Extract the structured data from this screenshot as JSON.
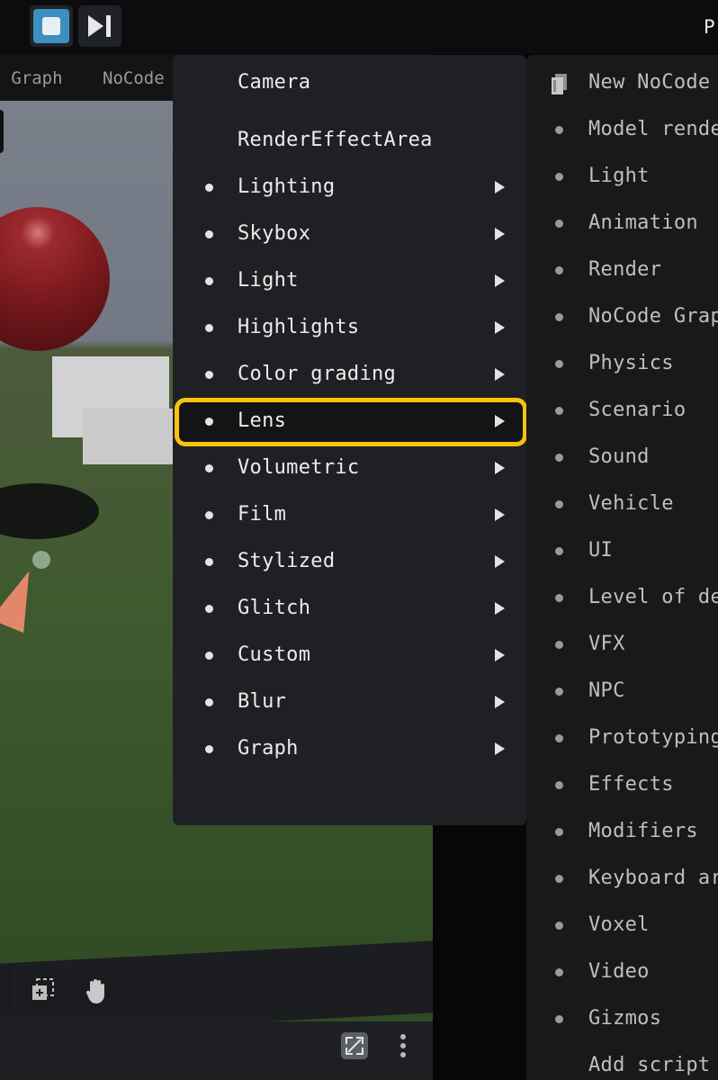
{
  "toolbar": {
    "stop_icon": "stop-icon",
    "step_icon": "step-forward-icon",
    "right_text": "P"
  },
  "tabs": [
    {
      "label": "al Graph"
    },
    {
      "label": "NoCode"
    }
  ],
  "viewport": {
    "tools": [
      {
        "icon": "tool-icon"
      },
      {
        "icon": "add-frame-icon"
      },
      {
        "icon": "hand-icon"
      }
    ],
    "bottom": {
      "fullscreen_icon": "fullscreen-icon",
      "more_icon": "more-vertical-icon"
    }
  },
  "menu": {
    "items": [
      {
        "label": "Camera",
        "bullet": false,
        "submenu": false,
        "highlighted": false
      },
      {
        "label": "RenderEffectArea",
        "bullet": false,
        "submenu": false,
        "highlighted": false
      },
      {
        "label": "Lighting",
        "bullet": true,
        "submenu": true,
        "highlighted": false
      },
      {
        "label": "Skybox",
        "bullet": true,
        "submenu": true,
        "highlighted": false
      },
      {
        "label": "Light",
        "bullet": true,
        "submenu": true,
        "highlighted": false
      },
      {
        "label": "Highlights",
        "bullet": true,
        "submenu": true,
        "highlighted": false
      },
      {
        "label": "Color grading",
        "bullet": true,
        "submenu": true,
        "highlighted": false
      },
      {
        "label": "Lens",
        "bullet": true,
        "submenu": true,
        "highlighted": true
      },
      {
        "label": "Volumetric",
        "bullet": true,
        "submenu": true,
        "highlighted": false
      },
      {
        "label": "Film",
        "bullet": true,
        "submenu": true,
        "highlighted": false
      },
      {
        "label": "Stylized",
        "bullet": true,
        "submenu": true,
        "highlighted": false
      },
      {
        "label": "Glitch",
        "bullet": true,
        "submenu": true,
        "highlighted": false
      },
      {
        "label": "Custom",
        "bullet": true,
        "submenu": true,
        "highlighted": false
      },
      {
        "label": "Blur",
        "bullet": true,
        "submenu": true,
        "highlighted": false
      },
      {
        "label": "Graph",
        "bullet": true,
        "submenu": true,
        "highlighted": false
      }
    ],
    "highlight_color": "#f6c20c"
  },
  "menu2": {
    "items": [
      {
        "label": "New NoCode",
        "icon": "file-icon"
      },
      {
        "label": "Model rende",
        "icon": "bullet"
      },
      {
        "label": "Light",
        "icon": "bullet"
      },
      {
        "label": "Animation",
        "icon": "bullet"
      },
      {
        "label": "Render",
        "icon": "bullet"
      },
      {
        "label": "NoCode Grap",
        "icon": "bullet"
      },
      {
        "label": "Physics",
        "icon": "bullet"
      },
      {
        "label": "Scenario",
        "icon": "bullet"
      },
      {
        "label": "Sound",
        "icon": "bullet"
      },
      {
        "label": "Vehicle",
        "icon": "bullet"
      },
      {
        "label": "UI",
        "icon": "bullet"
      },
      {
        "label": "Level of de",
        "icon": "bullet"
      },
      {
        "label": "VFX",
        "icon": "bullet"
      },
      {
        "label": "NPC",
        "icon": "bullet"
      },
      {
        "label": "Prototyping",
        "icon": "bullet"
      },
      {
        "label": "Effects",
        "icon": "bullet"
      },
      {
        "label": "Modifiers",
        "icon": "bullet"
      },
      {
        "label": "Keyboard ar",
        "icon": "bullet"
      },
      {
        "label": "Voxel",
        "icon": "bullet"
      },
      {
        "label": "Video",
        "icon": "bullet"
      },
      {
        "label": "Gizmos",
        "icon": "bullet"
      },
      {
        "label": "Add script",
        "icon": "none"
      }
    ]
  }
}
